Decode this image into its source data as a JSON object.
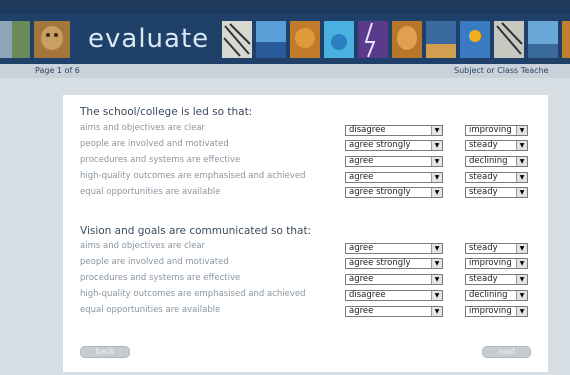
{
  "app": {
    "title": "evaluate"
  },
  "pagination": {
    "label": "Page 1 of 6"
  },
  "role_label": "Subject or Class Teache",
  "sections": [
    {
      "title": "The school/college is led so that:",
      "rows": [
        {
          "label": "aims and objectives are clear",
          "rating": "disagree",
          "trend": "improving"
        },
        {
          "label": "people are involved and motivated",
          "rating": "agree strongly",
          "trend": "steady"
        },
        {
          "label": "procedures and systems are effective",
          "rating": "agree",
          "trend": "declining"
        },
        {
          "label": "high-quality outcomes are emphasised and achieved",
          "rating": "agree",
          "trend": "steady"
        },
        {
          "label": "equal opportunities are available",
          "rating": "agree strongly",
          "trend": "steady"
        }
      ]
    },
    {
      "title": "Vision and goals are communicated so that:",
      "rows": [
        {
          "label": "aims and objectives are clear",
          "rating": "agree",
          "trend": "steady"
        },
        {
          "label": "people are involved and motivated",
          "rating": "agree strongly",
          "trend": "improving"
        },
        {
          "label": "procedures and systems are effective",
          "rating": "agree",
          "trend": "steady"
        },
        {
          "label": "high-quality outcomes are emphasised and achieved",
          "rating": "disagree",
          "trend": "declining"
        },
        {
          "label": "equal opportunities are available",
          "rating": "agree",
          "trend": "improving"
        }
      ]
    }
  ],
  "nav": {
    "back_label": "back",
    "next_label": "next"
  },
  "icons": {
    "dropdown": "chevron-down-icon"
  },
  "colors": {
    "banner": "#1f4068",
    "background": "#d6dde3",
    "card": "#ffffff"
  }
}
